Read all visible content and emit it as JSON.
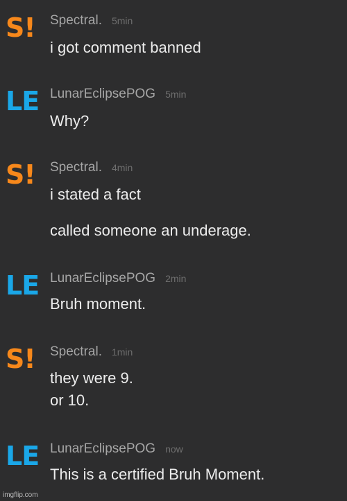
{
  "messages": [
    {
      "avatar": "S!",
      "user": "Spectral.",
      "time": "5min",
      "lines": [
        "i got comment banned"
      ]
    },
    {
      "avatar": "LE",
      "user": "LunarEclipsePOG",
      "time": "5min",
      "lines": [
        "Why?"
      ]
    },
    {
      "avatar": "S!",
      "user": "Spectral.",
      "time": "4min",
      "lines": [
        "i stated a fact",
        "called someone an underage."
      ]
    },
    {
      "avatar": "LE",
      "user": "LunarEclipsePOG",
      "time": "2min",
      "lines": [
        "Bruh moment."
      ]
    },
    {
      "avatar": "S!",
      "user": "Spectral.",
      "time": "1min",
      "lines": [
        "they were 9.",
        "or 10."
      ]
    },
    {
      "avatar": "LE",
      "user": "LunarEclipsePOG",
      "time": "now",
      "lines": [
        "This is a certified Bruh Moment."
      ]
    }
  ],
  "colors": {
    "background": "#2d2d2e",
    "spectral": "#f7881b",
    "lunar": "#1aa7e8"
  },
  "watermark": "imgflip.com"
}
